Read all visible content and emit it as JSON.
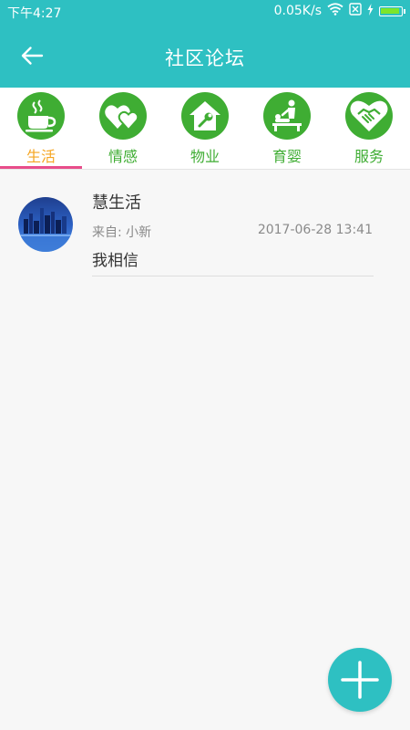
{
  "status_bar": {
    "time": "下午4:27",
    "network_speed": "0.05K/s",
    "battery_level": 0.95,
    "icons": [
      "wifi-icon",
      "sim-disabled-icon",
      "charging-icon",
      "battery-icon"
    ]
  },
  "header": {
    "title": "社区论坛",
    "back_icon": "arrow-left-icon"
  },
  "tabs": [
    {
      "label": "生活",
      "icon": "coffee-cup-icon",
      "active": true
    },
    {
      "label": "情感",
      "icon": "hearts-icon",
      "active": false
    },
    {
      "label": "物业",
      "icon": "house-wrench-icon",
      "active": false
    },
    {
      "label": "育婴",
      "icon": "baby-care-icon",
      "active": false
    },
    {
      "label": "服务",
      "icon": "handshake-heart-icon",
      "active": false
    }
  ],
  "posts": [
    {
      "title": "慧生活",
      "from": "来自: 小新",
      "date": "2017-06-28 13:41",
      "content": "我相信"
    }
  ],
  "fab": {
    "icon": "plus-icon"
  },
  "colors": {
    "primary": "#2ec0c2",
    "tab_icon_bg": "#3fad33",
    "tab_active_label": "#f5a623",
    "tab_indicator": "#e84d8a",
    "battery_fill": "#7de52b"
  }
}
